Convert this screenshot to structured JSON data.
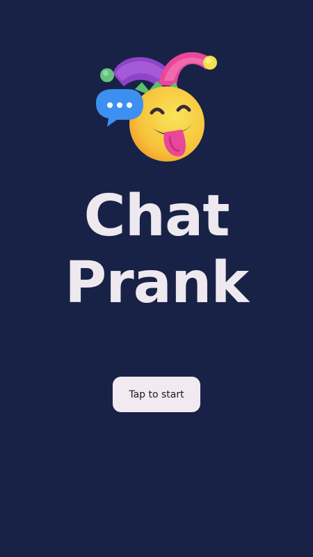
{
  "app": {
    "title_line1": "Chat",
    "title_line2": "Prank"
  },
  "logo": {
    "icon": "jester-emoji-with-chat-bubble-icon"
  },
  "start_button": {
    "label": "Tap to start"
  },
  "colors": {
    "background": "#182247",
    "title_text": "#eee8ef",
    "button_background": "#f2eaf0",
    "button_text": "#1a1a1a"
  }
}
